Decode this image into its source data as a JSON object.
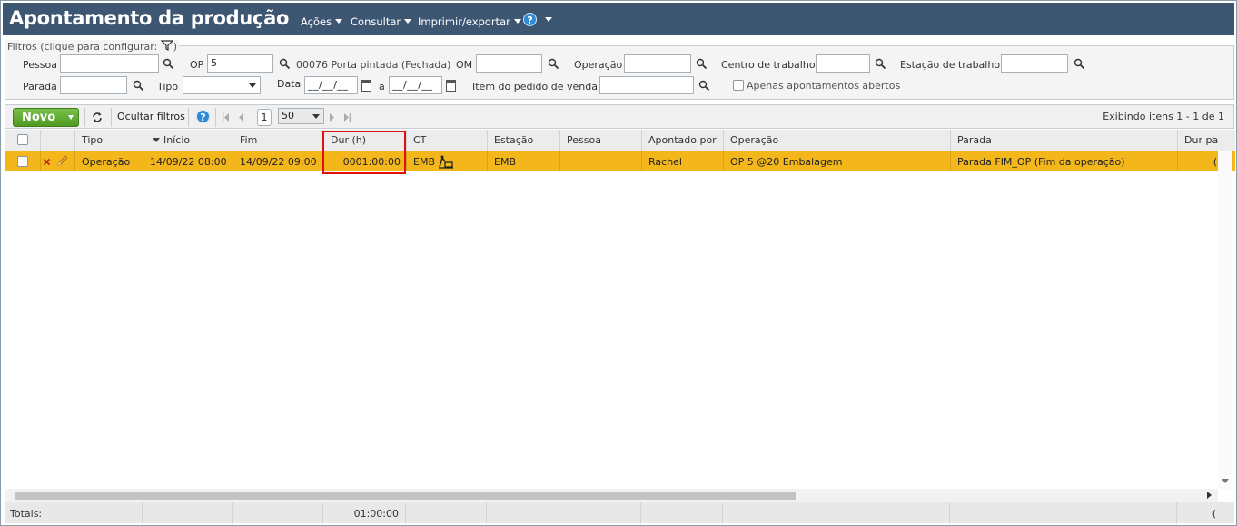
{
  "header": {
    "title": "Apontamento da produção",
    "menus": [
      "Ações",
      "Consultar",
      "Imprimir/exportar"
    ],
    "help_label": "?"
  },
  "filters": {
    "legend": "Filtros (clique para configurar:",
    "legend_close": ")",
    "pessoa_label": "Pessoa",
    "op_label": "OP",
    "op_value": "5",
    "op_desc": "00076 Porta pintada (Fechada)",
    "om_label": "OM",
    "operacao_label": "Operação",
    "centro_label": "Centro de trabalho",
    "estacao_label": "Estação de trabalho",
    "parada_label": "Parada",
    "tipo_label": "Tipo",
    "data_label": "Data",
    "date_from": "__/__/__",
    "date_to": "__/__/__",
    "date_sep": "a",
    "item_label": "Item do pedido de venda",
    "abertos_label": "Apenas apontamentos abertos"
  },
  "toolbar": {
    "novo_label": "Novo",
    "ocultar_label": "Ocultar filtros",
    "page": "1",
    "per_page": "50",
    "status": "Exibindo itens 1 - 1 de 1"
  },
  "grid": {
    "columns": [
      "Tipo",
      "Início",
      "Fim",
      "Dur (h)",
      "CT",
      "Estação",
      "Pessoa",
      "Apontado por",
      "Operação",
      "Parada",
      "Dur pa"
    ],
    "rows": [
      {
        "tipo": "Operação",
        "inicio": "14/09/22 08:00",
        "fim": "14/09/22 09:00",
        "dur": "0001:00:00",
        "ct": "EMB",
        "estacao": "EMB",
        "pessoa": "",
        "apontado": "Rachel",
        "operacao": "OP 5 @20 Embalagem",
        "parada": "Parada FIM_OP (Fim da operação)",
        "durpa": "("
      }
    ],
    "selected_row_color": "#f3b71c"
  },
  "totals": {
    "label": "Totais:",
    "dur_total": "01:00:00",
    "last": "("
  }
}
